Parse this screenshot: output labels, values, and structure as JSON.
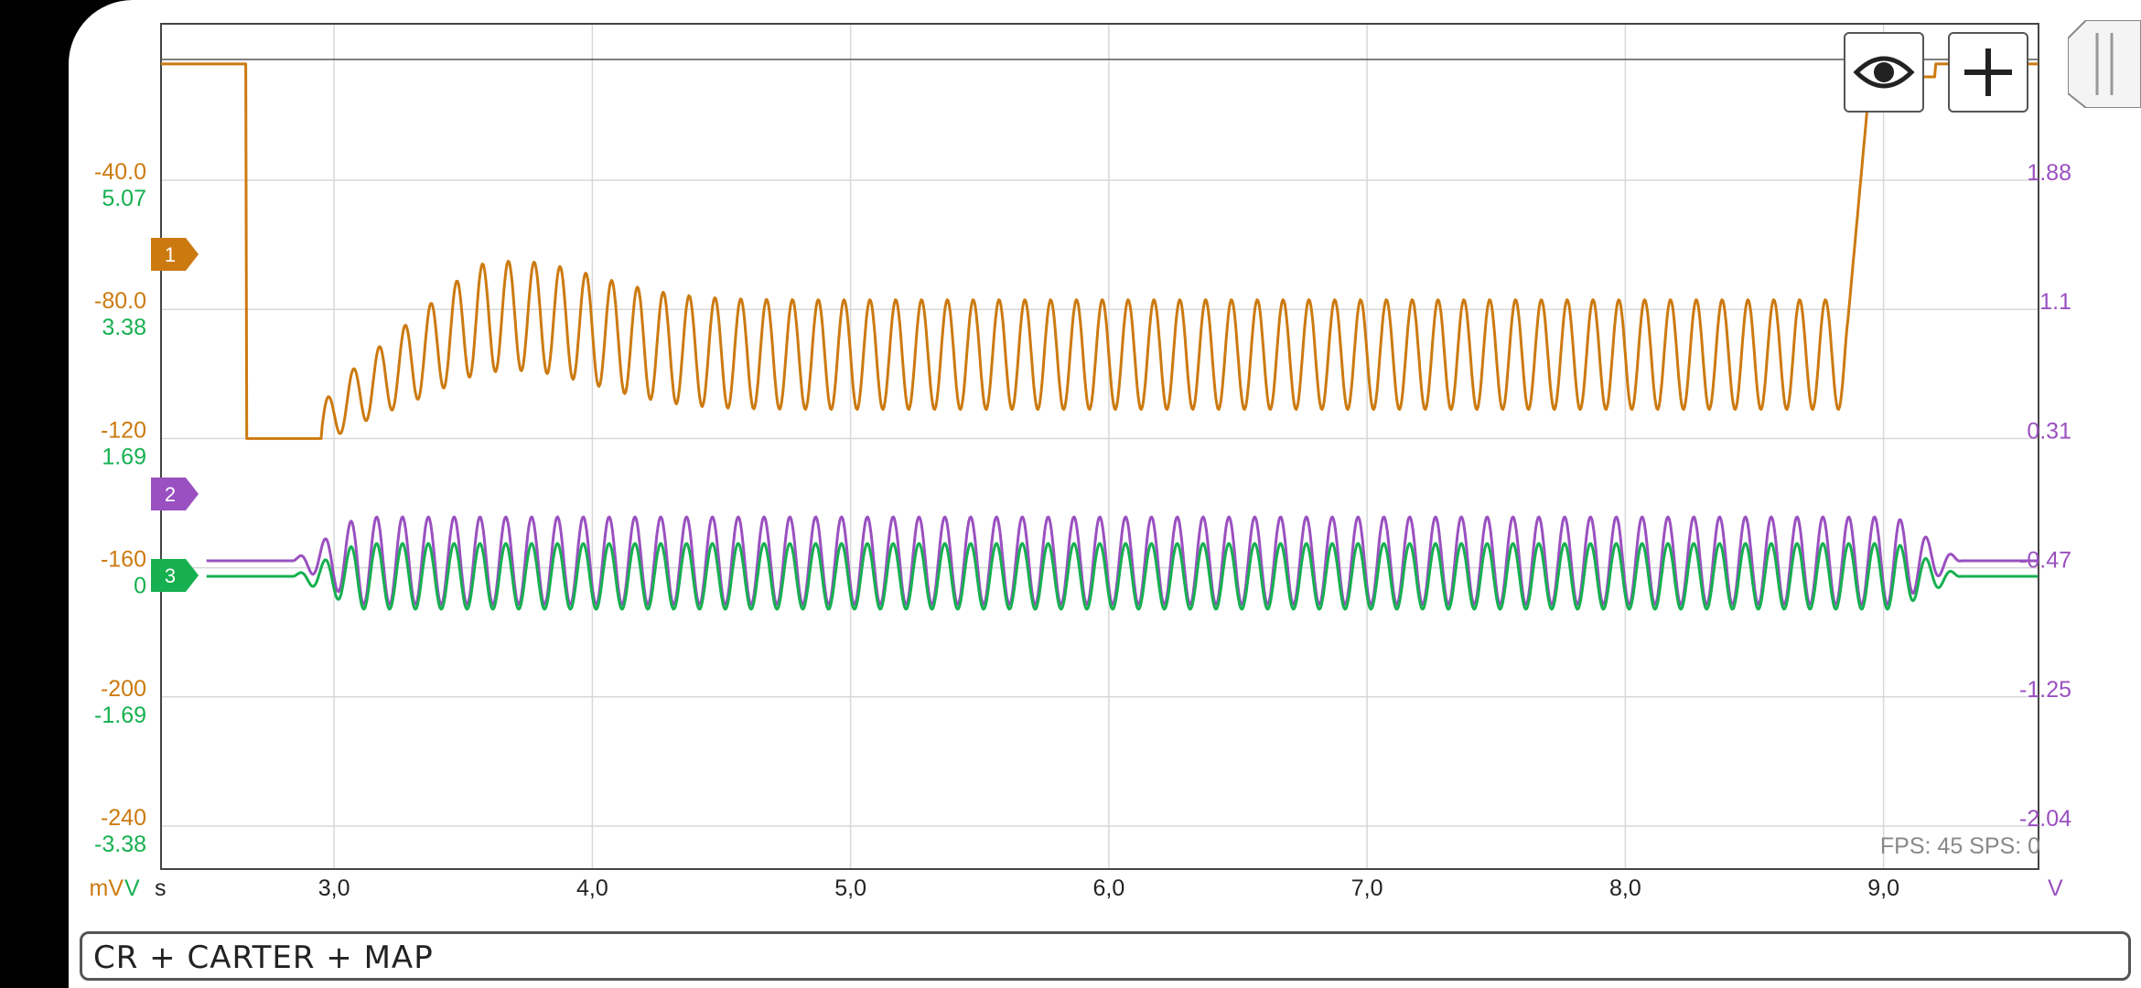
{
  "status": {
    "title": "CR + CARTER + MAP"
  },
  "fps": {
    "text": "FPS: 45   SPS: 0"
  },
  "toolbar": {
    "visibility_icon": "eye-icon",
    "add_icon": "plus-icon",
    "drawer_icon": "drawer-handle-icon"
  },
  "colors": {
    "ch1": "#cc7a10",
    "ch2": "#9a50c0",
    "ch3": "#16b050",
    "grid": "#d8d8d8",
    "frame": "#444444"
  },
  "chart_data": {
    "type": "line",
    "title": "",
    "x": {
      "unit": "s",
      "min": 2.33,
      "max": 9.6,
      "ticks": [
        "3,0",
        "4,0",
        "5,0",
        "6,0",
        "7,0",
        "8,0",
        "9,0"
      ],
      "tick_values": [
        3,
        4,
        5,
        6,
        7,
        8,
        9
      ]
    },
    "left_axis": {
      "units": "mV",
      "units2": "V",
      "ticks1": [
        "-40.0",
        "-80.0",
        "-120",
        "-160",
        "-200",
        "-240"
      ],
      "ticks2": [
        "5.07",
        "3.38",
        "1.69",
        "0",
        "-1.69",
        "-3.38"
      ]
    },
    "right_axis": {
      "unit": "V",
      "ticks": [
        "1.88",
        "1.1",
        "0.31",
        "-0.47",
        "-1.25",
        "-2.04"
      ]
    },
    "grid": true,
    "channel_markers": [
      "1",
      "2",
      "3"
    ],
    "series": [
      {
        "channel": "1",
        "unit": "mV",
        "levels": {
          "high": -4,
          "low": -120,
          "osc_mean": -94,
          "osc_amplitude": 17
        },
        "segments": [
          [
            2.33,
            2.66,
            "high"
          ],
          [
            2.66,
            2.95,
            "low"
          ],
          [
            2.95,
            3.55,
            "rise_osc"
          ],
          [
            3.55,
            8.83,
            "osc"
          ],
          [
            8.83,
            8.93,
            "end"
          ],
          [
            8.93,
            9.6,
            "high"
          ]
        ],
        "osc_period_s": 0.1
      },
      {
        "channel": "2",
        "unit": "V",
        "baseline": 0.0,
        "amplitude": 0.75,
        "active": [
          2.84,
          9.3
        ],
        "osc_period_s": 0.1
      },
      {
        "channel": "3",
        "unit": "V",
        "baseline": 0.0,
        "amplitude": 0.6,
        "active": [
          2.84,
          9.3
        ],
        "osc_period_s": 0.1
      }
    ]
  }
}
